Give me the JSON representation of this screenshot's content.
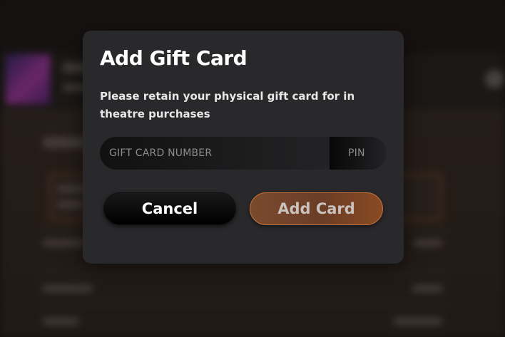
{
  "dialog": {
    "title": "Add Gift Card",
    "message": "Please retain your physical gift card for in theatre purchases",
    "card_number_placeholder": "GIFT CARD NUMBER",
    "pin_placeholder": "PIN",
    "cancel_label": "Cancel",
    "add_label": "Add Card"
  },
  "colors": {
    "modal_background": "#29282b",
    "accent_button": "#7a4a2e",
    "accent_border": "#c0713c"
  }
}
